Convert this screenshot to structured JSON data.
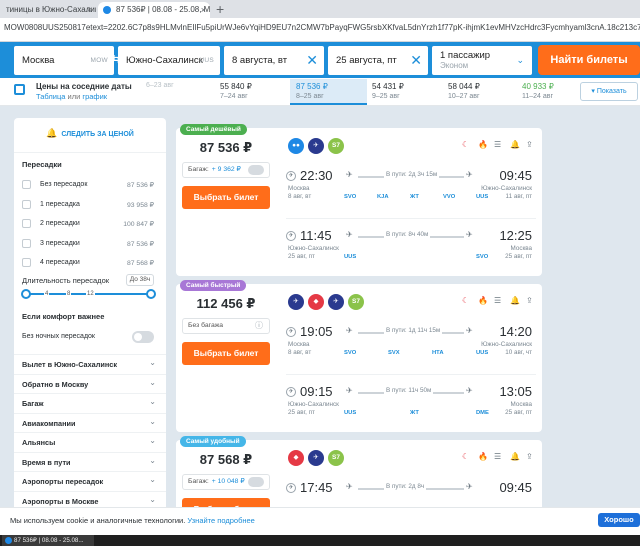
{
  "browser": {
    "tab1": "тиницы в Южно-Сахалинск",
    "tab2": "87 536₽ | 08.08 - 25.08, MOW",
    "close": "×",
    "new_tab": "+",
    "url": "MOW0808UUS250817etext=2202.6C7p8s9HLMvlnEIlFu5piUrWJe6vYqiHD9EU7n2CMW7bPayqFWG5rsbXKfvaL5dnYrzh1f77pK-ihjmK1evMHVzcHdrc3Fycmhyaml3cnA.18c213c7fb76b612e4935c0c71474f..."
  },
  "search": {
    "from": "Москва",
    "from_code": "MOW",
    "to": "Южно-Сахалинск",
    "to_code": "UUS",
    "depart": "8 августа, вт",
    "return": "25 августа, пт",
    "passengers": "1 пассажир",
    "cabin": "Эконом",
    "find": "Найти билеты",
    "swap_icon": "⇆",
    "clear_icon": "✕",
    "chevron": "⌄"
  },
  "calendar": {
    "title": "Цены на соседние даты",
    "sub_a": "Таблица",
    "sub_or": " или ",
    "sub_b": "график",
    "days": [
      {
        "price": "",
        "dates": "6–23 авг"
      },
      {
        "price": "55 840 ₽",
        "dates": "7–24 авг"
      },
      {
        "price": "87 536 ₽",
        "dates": "8–25 авг"
      },
      {
        "price": "54 431 ₽",
        "dates": "9–25 авг"
      },
      {
        "price": "58 044 ₽",
        "dates": "10–27 авг"
      },
      {
        "price": "40 933 ₽",
        "dates": "11–24 авг"
      }
    ],
    "show": "Показать"
  },
  "filters": {
    "subscribe": "СЛЕДИТЬ ЗА ЦЕНОЙ",
    "stops_title": "Пересадки",
    "stops": [
      {
        "label": "Без пересадок",
        "price": "87 536 ₽"
      },
      {
        "label": "1 пересадка",
        "price": "93 958 ₽"
      },
      {
        "label": "2 пересадки",
        "price": "100 847 ₽"
      },
      {
        "label": "3 пересадки",
        "price": "87 536 ₽"
      },
      {
        "label": "4 пересадки",
        "price": "87 568 ₽"
      }
    ],
    "duration_title": "Длительность пересадок",
    "duration_badge": "До 38ч",
    "ticks": [
      "4",
      "8",
      "12"
    ],
    "comfort": "Если комфорт важнее",
    "night": "Без ночных пересадок",
    "sections": [
      "Вылет в Южно-Сахалинск",
      "Обратно в Москву",
      "Багаж",
      "Авиакомпании",
      "Альянсы",
      "Время в пути",
      "Аэропорты пересадок",
      "Аэропорты в Москве"
    ],
    "chevron": "⌄"
  },
  "tickets": [
    {
      "badge": "Самый дешёвый",
      "badge_color": "#4caf50",
      "price": "87 536 ₽",
      "bag_label": "Багаж:",
      "bag_extra": "+ 9 362 ₽",
      "choose": "Выбрать билет",
      "logos": [
        "●●",
        "✈",
        "S7"
      ],
      "out": {
        "dep": "22:30",
        "arr": "09:45",
        "dur": "В пути: 2д 3ч 15м",
        "from_city": "Москва",
        "from_date": "8 авг, вт",
        "to_city": "Южно-Сахалинск",
        "to_date": "11 авг, пт",
        "codes": [
          "SVO",
          "KJA",
          "ЖТ",
          "VVO",
          "UUS"
        ]
      },
      "back": {
        "dep": "11:45",
        "arr": "12:25",
        "dur": "В пути: 8ч 40м",
        "from_city": "Южно-Сахалинск",
        "from_date": "25 авг, пт",
        "to_city": "Москва",
        "to_date": "25 авг, пт",
        "codes": [
          "UUS",
          "SVO"
        ]
      }
    },
    {
      "badge": "Самый быстрый",
      "badge_color": "#a877d6",
      "price": "112 456 ₽",
      "bag_label": "Без багажа",
      "bag_extra": "",
      "choose": "Выбрать билет",
      "logos": [
        "✈",
        "◆",
        "✈",
        "S7"
      ],
      "out": {
        "dep": "19:05",
        "arr": "14:20",
        "dur": "В пути: 1д 11ч 15м",
        "from_city": "Москва",
        "from_date": "8 авг, вт",
        "to_city": "Южно-Сахалинск",
        "to_date": "10 авг, чт",
        "codes": [
          "SVO",
          "SVX",
          "НТА",
          "UUS"
        ]
      },
      "back": {
        "dep": "09:15",
        "arr": "13:05",
        "dur": "В пути: 11ч 50м",
        "from_city": "Южно-Сахалинск",
        "from_date": "25 авг, пт",
        "to_city": "Москва",
        "to_date": "25 авг, пт",
        "codes": [
          "UUS",
          "ЖТ",
          "DME"
        ]
      }
    },
    {
      "badge": "Самый удобный",
      "badge_color": "#45b6e8",
      "price": "87 568 ₽",
      "bag_label": "Багаж:",
      "bag_extra": "+ 10 048 ₽",
      "choose": "Выбрать билет",
      "logos": [
        "◆",
        "✈",
        "S7"
      ],
      "out": {
        "dep": "17:45",
        "arr": "09:45",
        "dur": "В пути: 2д 8ч",
        "from_city": "",
        "from_date": "",
        "to_city": "",
        "to_date": "",
        "codes": []
      },
      "back": null
    }
  ],
  "card_icons": [
    "moon-icon",
    "flame-icon",
    "list-icon",
    "bell-icon",
    "share-icon"
  ],
  "cookie": {
    "text": "Мы используем cookie и аналогичные технологии. ",
    "link": "Узнайте подробнее",
    "ok": "Хорошо"
  },
  "taskbar": {
    "item": "87 536₽ | 08.08 - 25.08..."
  },
  "colors": {
    "brand": "#1d8ed9",
    "accent": "#ff6d1a"
  }
}
